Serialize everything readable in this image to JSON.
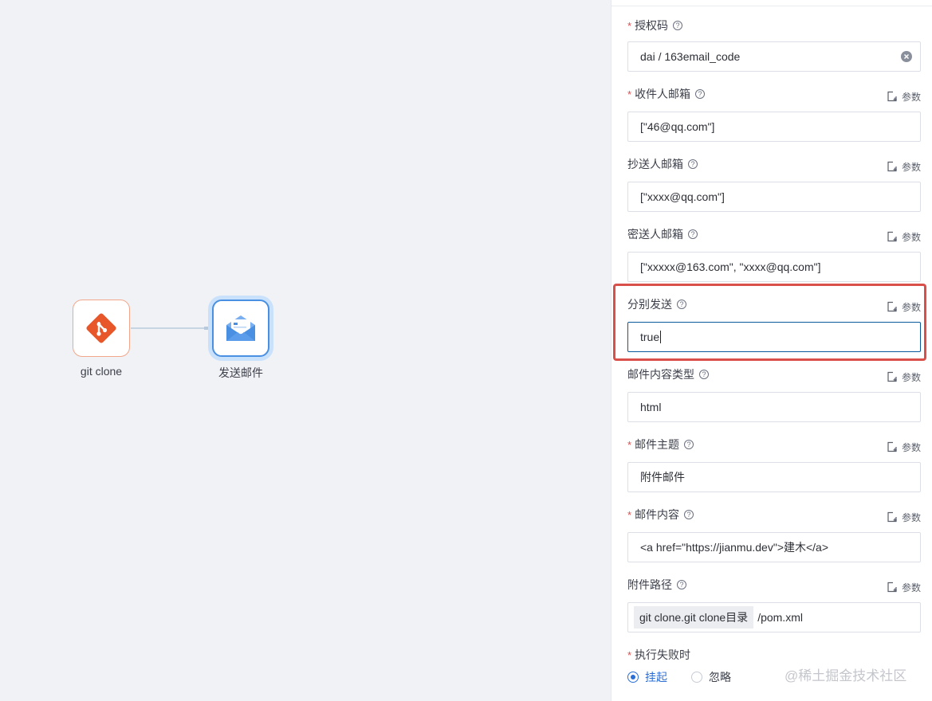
{
  "canvas": {
    "nodes": [
      {
        "label": "git clone",
        "icon": "git-icon",
        "color": "#e8572a"
      },
      {
        "label": "发送邮件",
        "icon": "open-envelope-icon",
        "color": "#4a90e2"
      }
    ]
  },
  "panel": {
    "fields": [
      {
        "label": "授权码",
        "required": true,
        "value": "dai / 163email_code",
        "has_param": false,
        "has_clear": true
      },
      {
        "label": "收件人邮箱",
        "required": true,
        "value": "[\"46@qq.com\"]",
        "has_param": true
      },
      {
        "label": "抄送人邮箱",
        "required": false,
        "value": "[\"xxxx@qq.com\"]",
        "has_param": true
      },
      {
        "label": "密送人邮箱",
        "required": false,
        "value": "[\"xxxxx@163.com\", \"xxxx@qq.com\"]",
        "has_param": true
      },
      {
        "label": "分别发送",
        "required": false,
        "value": "true",
        "has_param": true,
        "focused": true
      },
      {
        "label": "邮件内容类型",
        "required": false,
        "value": "html",
        "has_param": true
      },
      {
        "label": "邮件主题",
        "required": true,
        "value": "附件邮件",
        "has_param": true
      },
      {
        "label": "邮件内容",
        "required": true,
        "value": "<a href=\"https://jianmu.dev\">建木</a>",
        "has_param": true
      },
      {
        "label": "附件路径",
        "required": false,
        "tag": "git clone.git clone目录",
        "value": "/pom.xml",
        "has_param": true
      }
    ],
    "param_label": "参数",
    "help_glyph": "?",
    "required_mark": "*",
    "on_failure": {
      "label": "执行失败时",
      "required": true,
      "options": [
        {
          "label": "挂起",
          "checked": true
        },
        {
          "label": "忽略",
          "checked": false
        }
      ]
    }
  },
  "watermark": "@稀土掘金技术社区",
  "colors": {
    "accent": "#2b6fd6",
    "highlight": "#d94f4a",
    "required": "#e24c4c",
    "git": "#e8572a"
  }
}
